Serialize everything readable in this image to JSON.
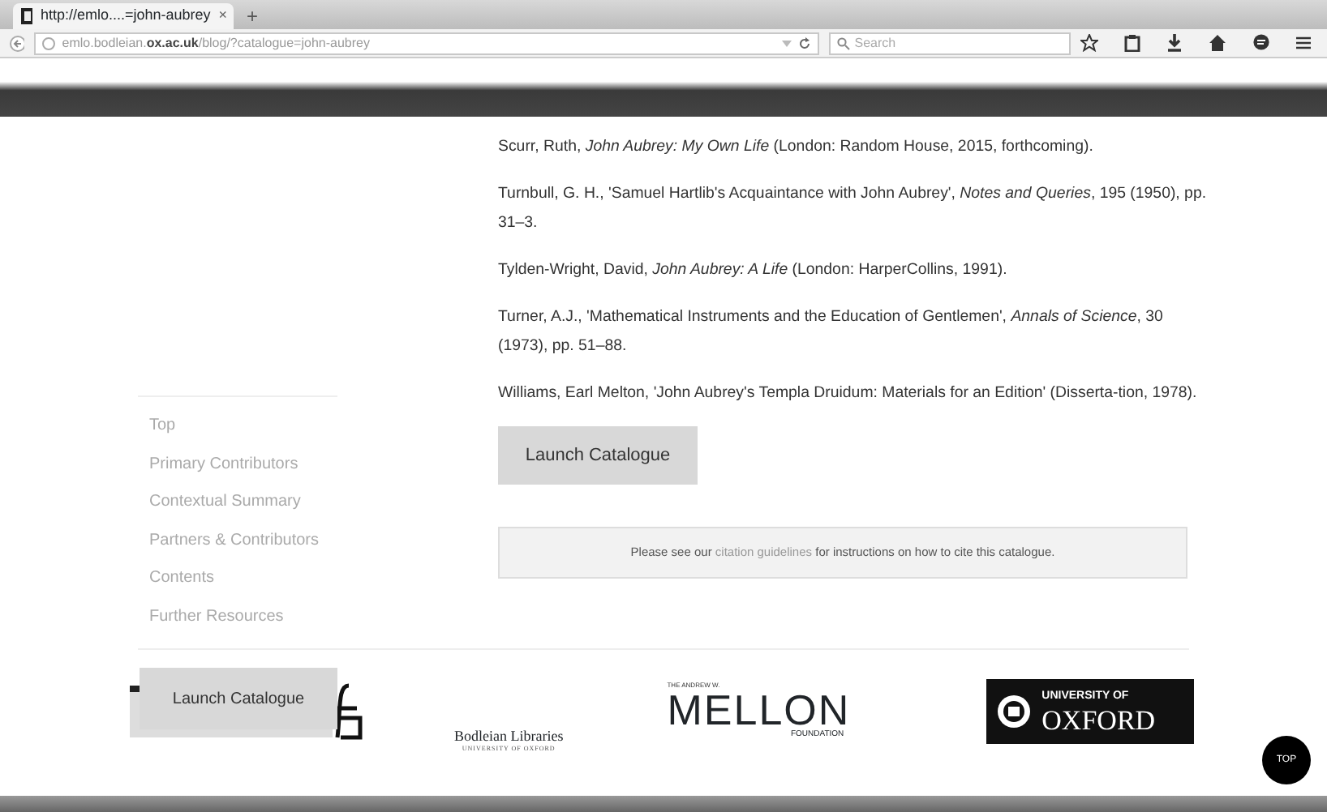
{
  "browser": {
    "tab_title": "http://emlo....=john-aubrey",
    "tab_close": "×",
    "new_tab": "+",
    "url_prefix": "emlo.bodleian.",
    "url_domain": "ox.ac.uk",
    "url_path": "/blog/?catalogue=john-aubrey",
    "search_placeholder": "Search"
  },
  "sidebar": {
    "items": [
      {
        "label": "Top"
      },
      {
        "label": "Primary Contributors"
      },
      {
        "label": "Contextual Summary"
      },
      {
        "label": "Partners & Contributors"
      },
      {
        "label": "Contents"
      },
      {
        "label": "Further Resources"
      }
    ]
  },
  "references": [
    "Scurr, Ruth, *John Aubrey: My Own Life* (London: Random House, 2015, forthcoming).",
    "Turnbull, G. H., 'Samuel Hartlib's Acquaintance with John Aubrey', *Notes and Queries*, 195 (1950), pp. 31–3.",
    "Tylden-Wright, David, *John Aubrey: A Life* (London: HarperCollins, 1991).",
    "Turner, A.J., 'Mathematical Instruments and the Education of Gentlemen', *Annals of Science*, 30 (1973), pp. 51–88.",
    "Williams, Earl Melton, 'John Aubrey's Templa Druidum: Materials for an Edition' (Disserta-tion, 1978)."
  ],
  "launch_button": "Launch Catalogue",
  "citation": {
    "before": "Please see our",
    "link": "citation guidelines",
    "after": "for instructions on how to cite this catalogue."
  },
  "footer": {
    "floating_button": "Launch Catalogue",
    "bodleian": "Bodleian Libraries",
    "bodleian_sub": "UNIVERSITY OF OXFORD",
    "mellon_top": "THE ANDREW W.",
    "mellon": "MELLON",
    "mellon_sub": "FOUNDATION",
    "oxford_top": "UNIVERSITY OF",
    "oxford": "OXFORD",
    "top_button": "TOP"
  }
}
